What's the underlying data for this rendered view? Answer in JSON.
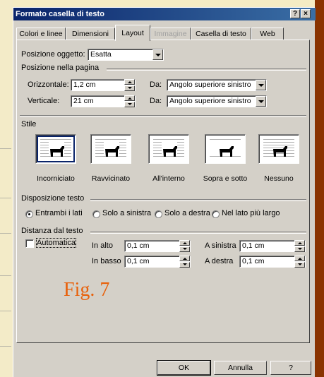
{
  "window": {
    "title": "Formato casella di testo",
    "help_btn": "?",
    "close_btn": "×"
  },
  "tabs": [
    {
      "label": "Colori e linee"
    },
    {
      "label": "Dimensioni"
    },
    {
      "label": "Layout"
    },
    {
      "label": "Immagine"
    },
    {
      "label": "Casella di testo"
    },
    {
      "label": "Web"
    }
  ],
  "posizione_oggetto": {
    "label": "Posizione oggetto:",
    "value": "Esatta"
  },
  "posizione_pagina": {
    "group_label": "Posizione nella pagina",
    "orizzontale_label": "Orizzontale:",
    "orizzontale_value": "1,2 cm",
    "verticale_label": "Verticale:",
    "verticale_value": "21 cm",
    "da_label": "Da:",
    "da_orizz_value": "Angolo superiore sinistro",
    "da_vert_value": "Angolo superiore sinistro"
  },
  "stile": {
    "label": "Stile",
    "options": [
      {
        "label": "Incorniciato"
      },
      {
        "label": "Ravvicinato"
      },
      {
        "label": "All'interno"
      },
      {
        "label": "Sopra e sotto"
      },
      {
        "label": "Nessuno"
      }
    ]
  },
  "disposizione": {
    "group_label": "Disposizione testo",
    "options": [
      {
        "label": "Entrambi i lati",
        "selected": true
      },
      {
        "label": "Solo a sinistra",
        "selected": false
      },
      {
        "label": "Solo a destra",
        "selected": false
      },
      {
        "label": "Nel lato più largo",
        "selected": false
      }
    ]
  },
  "distanza": {
    "group_label": "Distanza dal testo",
    "automatica_label": "Automatica",
    "in_alto_label": "In alto",
    "in_alto_value": "0,1 cm",
    "in_basso_label": "In basso",
    "in_basso_value": "0,1 cm",
    "a_sinistra_label": "A sinistra",
    "a_sinistra_value": "0,1 cm",
    "a_destra_label": "A destra",
    "a_destra_value": "0,1 cm"
  },
  "caption": "Fig. 7",
  "buttons": {
    "ok": "OK",
    "annulla": "Annulla",
    "help": "?"
  }
}
